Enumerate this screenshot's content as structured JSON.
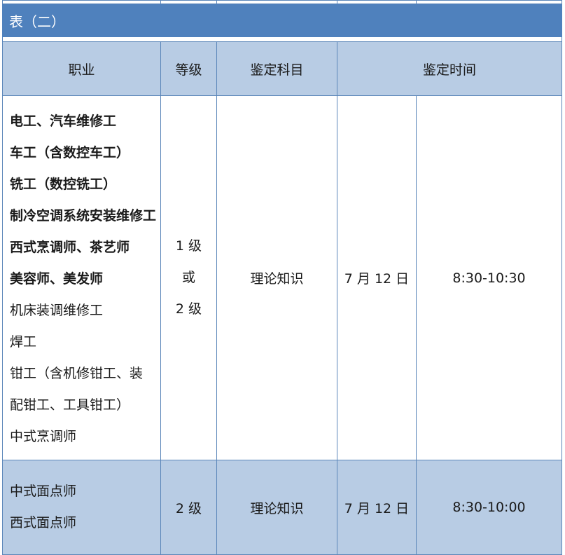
{
  "table_title": "表（二）",
  "headers": {
    "occupation": "职业",
    "level": "等级",
    "subject": "鉴定科目",
    "time": "鉴定时间"
  },
  "rows": [
    {
      "occupations": [
        {
          "text": "电工、汽车维修工",
          "bold": true
        },
        {
          "text": "车工（含数控车工）",
          "bold": true
        },
        {
          "text": "铣工（数控铣工）",
          "bold": true
        },
        {
          "text": "制冷空调系统安装维修工",
          "bold": true
        },
        {
          "text": "西式烹调师、茶艺师",
          "bold": true
        },
        {
          "text": "美容师、美发师",
          "bold": true
        },
        {
          "text": "机床装调维修工",
          "bold": false
        },
        {
          "text": "焊工",
          "bold": false
        },
        {
          "text": "钳工（含机修钳工、装",
          "bold": false
        },
        {
          "text": "配钳工、工具钳工）",
          "bold": false
        },
        {
          "text": "中式烹调师",
          "bold": false
        }
      ],
      "level_lines": [
        "1 级",
        "或",
        "2 级"
      ],
      "subject": "理论知识",
      "date": "7 月 12 日",
      "time": "8:30-10:30"
    },
    {
      "occupations": [
        {
          "text": "中式面点师",
          "bold": false
        },
        {
          "text": "西式面点师",
          "bold": false
        }
      ],
      "level": "2 级",
      "subject": "理论知识",
      "date": "7 月 12 日",
      "time": "8:30-10:00"
    }
  ]
}
